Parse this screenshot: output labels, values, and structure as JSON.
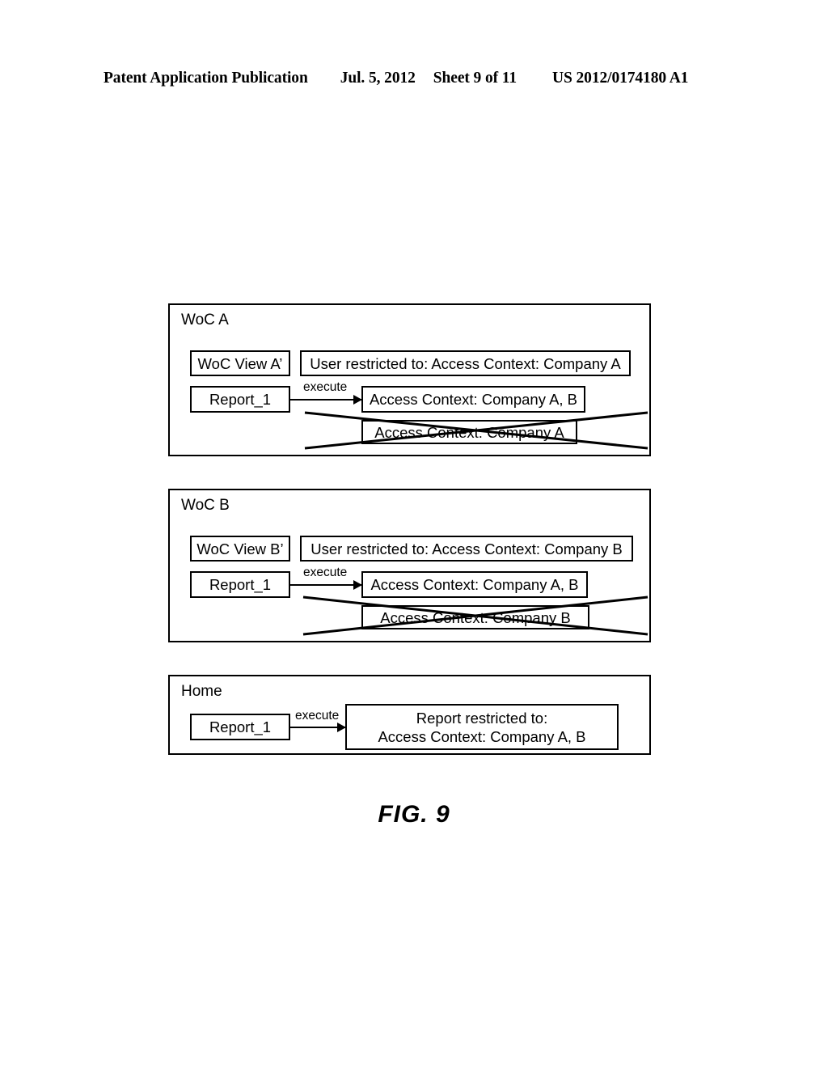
{
  "header": {
    "publication": "Patent Application Publication",
    "date": "Jul. 5, 2012",
    "sheet": "Sheet 9 of 11",
    "patent_number": "US 2012/0174180 A1"
  },
  "figure": {
    "caption": "FIG.  9",
    "groups": [
      {
        "title": "WoC A",
        "view_label": "WoC View A’",
        "restriction_label": "User restricted to: Access Context: Company A",
        "report_label": "Report_1",
        "arrow_label": "execute",
        "context_label": "Access Context: Company A, B",
        "struck_context_label": "Access Context: Company A"
      },
      {
        "title": "WoC B",
        "view_label": "WoC View B’",
        "restriction_label": "User restricted to: Access Context: Company B",
        "report_label": "Report_1",
        "arrow_label": "execute",
        "context_label": "Access Context: Company A, B",
        "struck_context_label": "Access Context: Company B"
      }
    ],
    "home": {
      "title": "Home",
      "report_label": "Report_1",
      "arrow_label": "execute",
      "result_line1": "Report restricted to:",
      "result_line2": "Access Context: Company A, B"
    }
  },
  "colors": {
    "ink": "#000000",
    "paper": "#ffffff"
  }
}
